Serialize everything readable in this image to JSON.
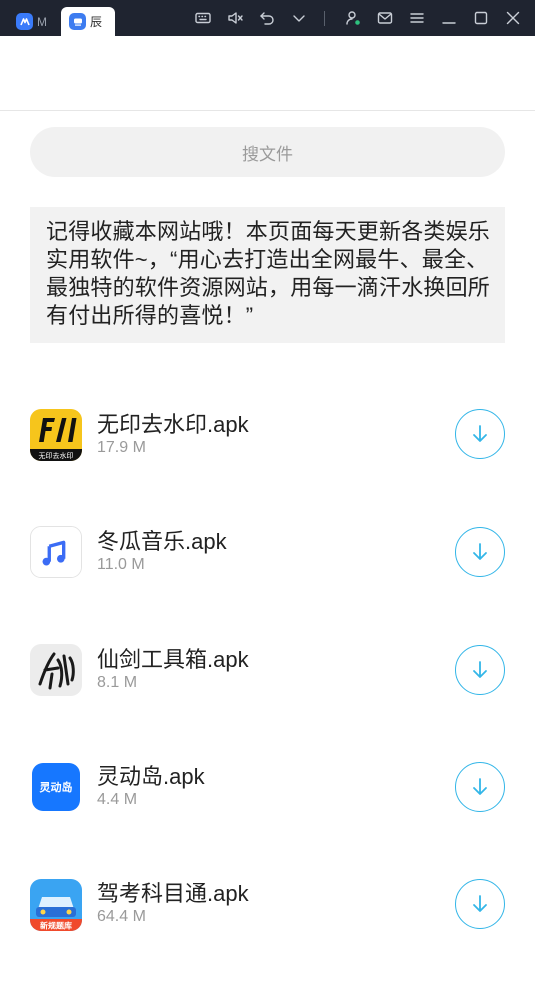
{
  "topbar": {
    "tabs": [
      {
        "label": "M",
        "icon": "app-logo-icon"
      },
      {
        "label": "辰",
        "icon": "app-logo-icon"
      }
    ],
    "controls": [
      "keyboard-icon",
      "volume-mute-icon",
      "undo-icon",
      "chevron-down-icon",
      "account-icon",
      "mail-icon",
      "menu-icon",
      "minimize-icon",
      "maximize-icon",
      "close-icon"
    ]
  },
  "search": {
    "placeholder": "搜文件"
  },
  "notice": {
    "text": "记得收藏本网站哦！本页面每天更新各类娱乐实用软件~，“用心去打造出全网最牛、最全、最独特的软件资源网站，用每一滴汗水换回所有付出所得的喜悦！”"
  },
  "files": [
    {
      "name": "无印去水印.apk",
      "size": "17.9 M",
      "icon_text": "无印去水印"
    },
    {
      "name": "冬瓜音乐.apk",
      "size": "11.0 M"
    },
    {
      "name": "仙剑工具箱.apk",
      "size": "8.1 M"
    },
    {
      "name": "灵动岛.apk",
      "size": "4.4 M",
      "icon_text": "灵动岛"
    },
    {
      "name": "驾考科目通.apk",
      "size": "64.4 M",
      "icon_text": "新规题库"
    }
  ],
  "colors": {
    "accent": "#33b6e8",
    "topbar": "#1f2430"
  }
}
